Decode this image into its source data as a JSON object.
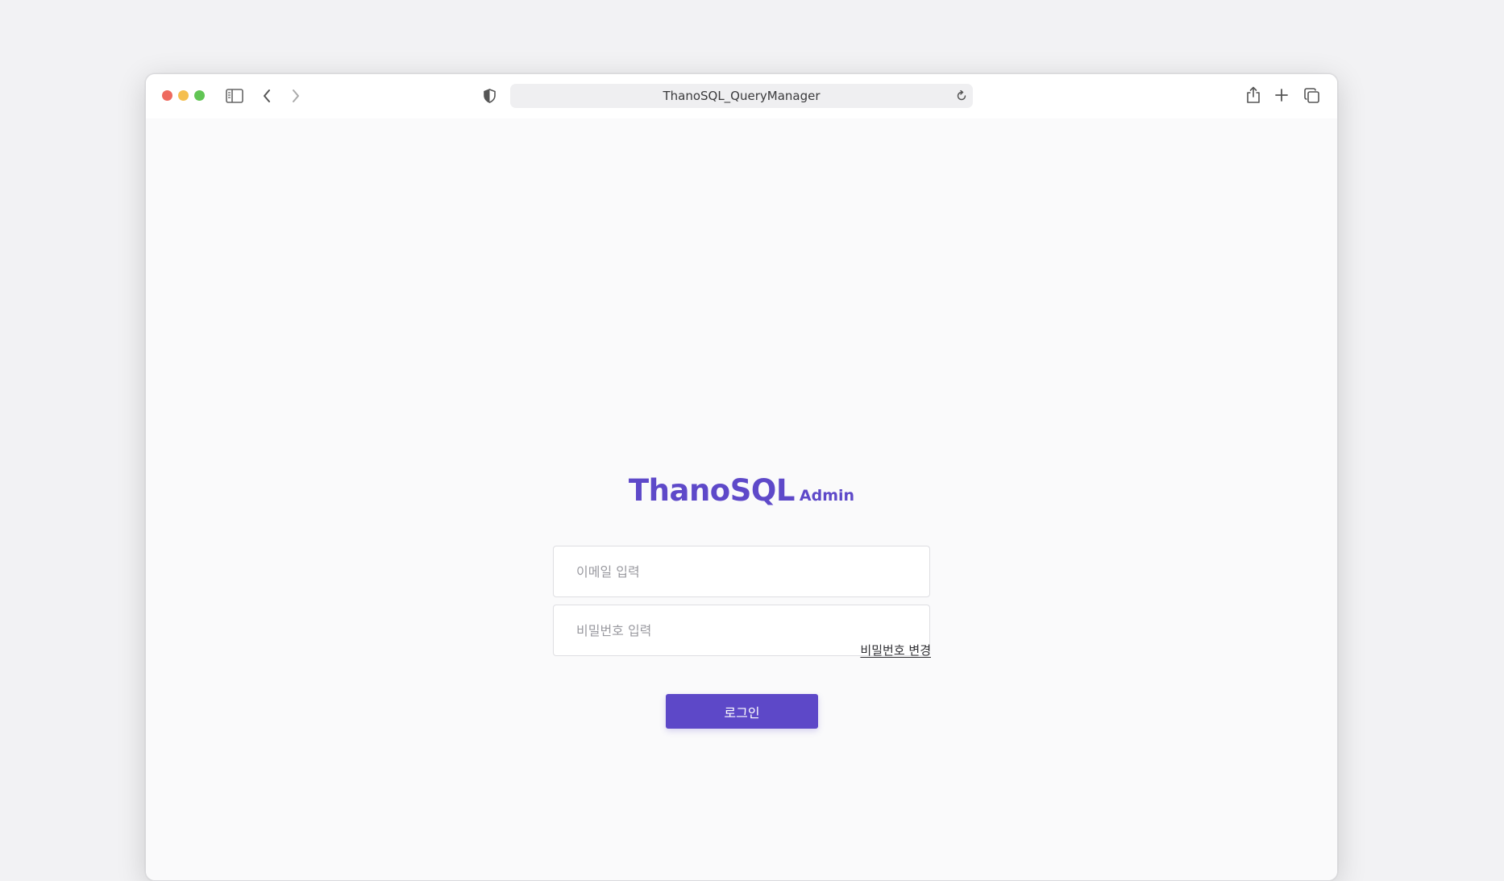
{
  "browser": {
    "url_title": "ThanoSQL_QueryManager",
    "icons": {
      "sidebar": "sidebar-icon",
      "back": "chevron-left-icon",
      "forward": "chevron-right-icon",
      "privacy": "shield-icon",
      "reload": "reload-icon",
      "share": "share-icon",
      "new_tab": "plus-icon",
      "tabs": "tabs-overview-icon"
    }
  },
  "login": {
    "brand_name": "ThanoSQL",
    "brand_suffix": "Admin",
    "email_placeholder": "이메일 입력",
    "password_placeholder": "비밀번호 입력",
    "change_password_label": "비밀번호 변경",
    "submit_label": "로그인"
  },
  "colors": {
    "brand": "#5e49c9",
    "button": "#5d48c8",
    "page_background": "#fafafb",
    "desktop_background": "#f2f2f4"
  }
}
